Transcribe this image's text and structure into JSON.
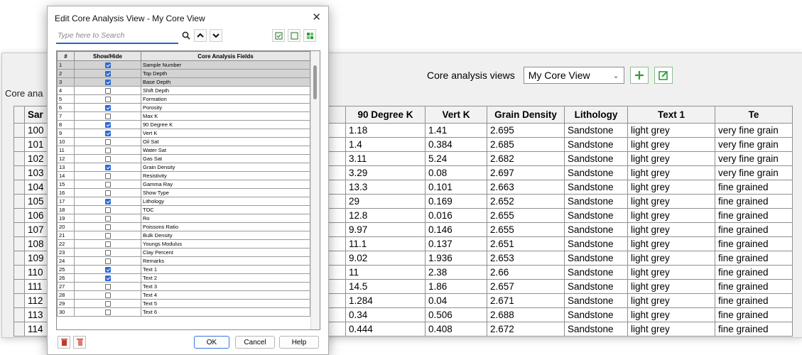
{
  "main": {
    "views_label": "Core analysis views",
    "selected_view": "My Core View",
    "core_label": "Core ana",
    "columns": [
      "Sar",
      "90 Degree K",
      "Vert K",
      "Grain Density",
      "Lithology",
      "Text 1",
      "Te"
    ],
    "rows": [
      [
        "100",
        "1.18",
        "1.41",
        "2.695",
        "Sandstone",
        "light grey",
        "very fine grain"
      ],
      [
        "101",
        "1.4",
        "0.384",
        "2.685",
        "Sandstone",
        "light grey",
        "very fine grain"
      ],
      [
        "102",
        "3.11",
        "5.24",
        "2.682",
        "Sandstone",
        "light grey",
        "very fine grain"
      ],
      [
        "103",
        "3.29",
        "0.08",
        "2.697",
        "Sandstone",
        "light grey",
        "very fine grain"
      ],
      [
        "104",
        "13.3",
        "0.101",
        "2.663",
        "Sandstone",
        "light grey",
        "fine grained"
      ],
      [
        "105",
        "29",
        "0.169",
        "2.652",
        "Sandstone",
        "light grey",
        "fine grained"
      ],
      [
        "106",
        "12.8",
        "0.016",
        "2.655",
        "Sandstone",
        "light grey",
        "fine grained"
      ],
      [
        "107",
        "9.97",
        "0.146",
        "2.655",
        "Sandstone",
        "light grey",
        "fine grained"
      ],
      [
        "108",
        "11.1",
        "0.137",
        "2.651",
        "Sandstone",
        "light grey",
        "fine grained"
      ],
      [
        "109",
        "9.02",
        "1.936",
        "2.653",
        "Sandstone",
        "light grey",
        "fine grained"
      ],
      [
        "110",
        "11",
        "2.38",
        "2.66",
        "Sandstone",
        "light grey",
        "fine grained"
      ],
      [
        "111",
        "14.5",
        "1.86",
        "2.657",
        "Sandstone",
        "light grey",
        "fine grained"
      ],
      [
        "112",
        "1.284",
        "0.04",
        "2.671",
        "Sandstone",
        "light grey",
        "fine grained"
      ],
      [
        "113",
        "0.34",
        "0.506",
        "2.688",
        "Sandstone",
        "light grey",
        "fine grained"
      ],
      [
        "114",
        "0.444",
        "0.408",
        "2.672",
        "Sandstone",
        "light grey",
        "fine grained"
      ]
    ]
  },
  "dialog": {
    "title": "Edit Core Analysis View - My Core View",
    "close_glyph": "✕",
    "search_placeholder": "Type here to Search",
    "headers": [
      "#",
      "Show/Hide",
      "Core Analysis Fields"
    ],
    "fields": [
      {
        "n": "1",
        "on": true,
        "hl": true,
        "name": "Sample Number"
      },
      {
        "n": "2",
        "on": true,
        "hl": true,
        "name": "Top Depth"
      },
      {
        "n": "3",
        "on": true,
        "hl": true,
        "name": "Base Depth"
      },
      {
        "n": "4",
        "on": false,
        "hl": false,
        "name": "Shift Depth"
      },
      {
        "n": "5",
        "on": false,
        "hl": false,
        "name": "Formation"
      },
      {
        "n": "6",
        "on": true,
        "hl": false,
        "name": "Porosity"
      },
      {
        "n": "7",
        "on": false,
        "hl": false,
        "name": "Max K"
      },
      {
        "n": "8",
        "on": true,
        "hl": false,
        "name": "90 Degree K"
      },
      {
        "n": "9",
        "on": true,
        "hl": false,
        "name": "Vert K"
      },
      {
        "n": "10",
        "on": false,
        "hl": false,
        "name": "Oil Sat"
      },
      {
        "n": "11",
        "on": false,
        "hl": false,
        "name": "Water Sat"
      },
      {
        "n": "12",
        "on": false,
        "hl": false,
        "name": "Gas Sat"
      },
      {
        "n": "13",
        "on": true,
        "hl": false,
        "name": "Grain Density"
      },
      {
        "n": "14",
        "on": false,
        "hl": false,
        "name": "Resistivity"
      },
      {
        "n": "15",
        "on": false,
        "hl": false,
        "name": "Gamma Ray"
      },
      {
        "n": "16",
        "on": false,
        "hl": false,
        "name": "Show Type"
      },
      {
        "n": "17",
        "on": true,
        "hl": false,
        "name": "Lithology"
      },
      {
        "n": "18",
        "on": false,
        "hl": false,
        "name": "TOC"
      },
      {
        "n": "19",
        "on": false,
        "hl": false,
        "name": "Ro"
      },
      {
        "n": "20",
        "on": false,
        "hl": false,
        "name": "Poissons Ratio"
      },
      {
        "n": "21",
        "on": false,
        "hl": false,
        "name": "Bulk Density"
      },
      {
        "n": "22",
        "on": false,
        "hl": false,
        "name": "Youngs Modulus"
      },
      {
        "n": "23",
        "on": false,
        "hl": false,
        "name": "Clay Percent"
      },
      {
        "n": "24",
        "on": false,
        "hl": false,
        "name": "Remarks"
      },
      {
        "n": "25",
        "on": true,
        "hl": false,
        "name": "Text 1"
      },
      {
        "n": "26",
        "on": true,
        "hl": false,
        "name": "Text 2"
      },
      {
        "n": "27",
        "on": false,
        "hl": false,
        "name": "Text 3"
      },
      {
        "n": "28",
        "on": false,
        "hl": false,
        "name": "Text 4"
      },
      {
        "n": "29",
        "on": false,
        "hl": false,
        "name": "Text 5"
      },
      {
        "n": "30",
        "on": false,
        "hl": false,
        "name": "Text 6"
      }
    ],
    "ok_label": "OK",
    "cancel_label": "Cancel",
    "help_label": "Help"
  },
  "colors": {
    "accent": "#2d6ad4",
    "green_icon": "#2e9e3a",
    "delete_icon": "#c0392b"
  }
}
